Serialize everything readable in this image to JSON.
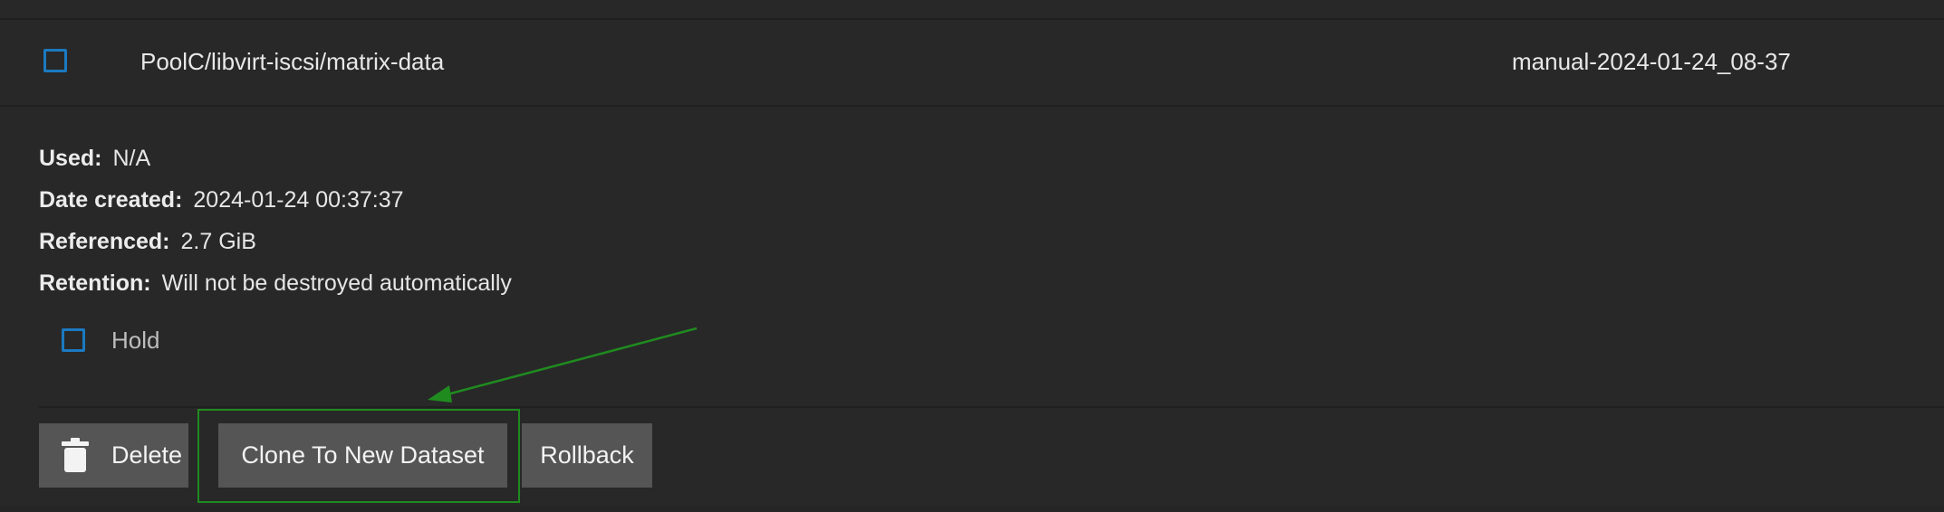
{
  "row": {
    "dataset": "PoolC/libvirt-iscsi/matrix-data",
    "snapshot": "manual-2024-01-24_08-37"
  },
  "details": {
    "used_label": "Used:",
    "used_value": "N/A",
    "date_label": "Date created:",
    "date_value": "2024-01-24 00:37:37",
    "referenced_label": "Referenced:",
    "referenced_value": "2.7 GiB",
    "retention_label": "Retention:",
    "retention_value": "Will not be destroyed automatically"
  },
  "hold": {
    "label": "Hold",
    "checked": false
  },
  "actions": {
    "delete_label": "Delete",
    "clone_label": "Clone To New Dataset",
    "rollback_label": "Rollback"
  },
  "colors": {
    "background": "#282828",
    "checkbox_border": "#1b7ac1",
    "button_bg": "#555555",
    "highlight": "#1f8b1f"
  },
  "icons": {
    "delete": "trash-icon",
    "checkbox": "checkbox-icon"
  }
}
